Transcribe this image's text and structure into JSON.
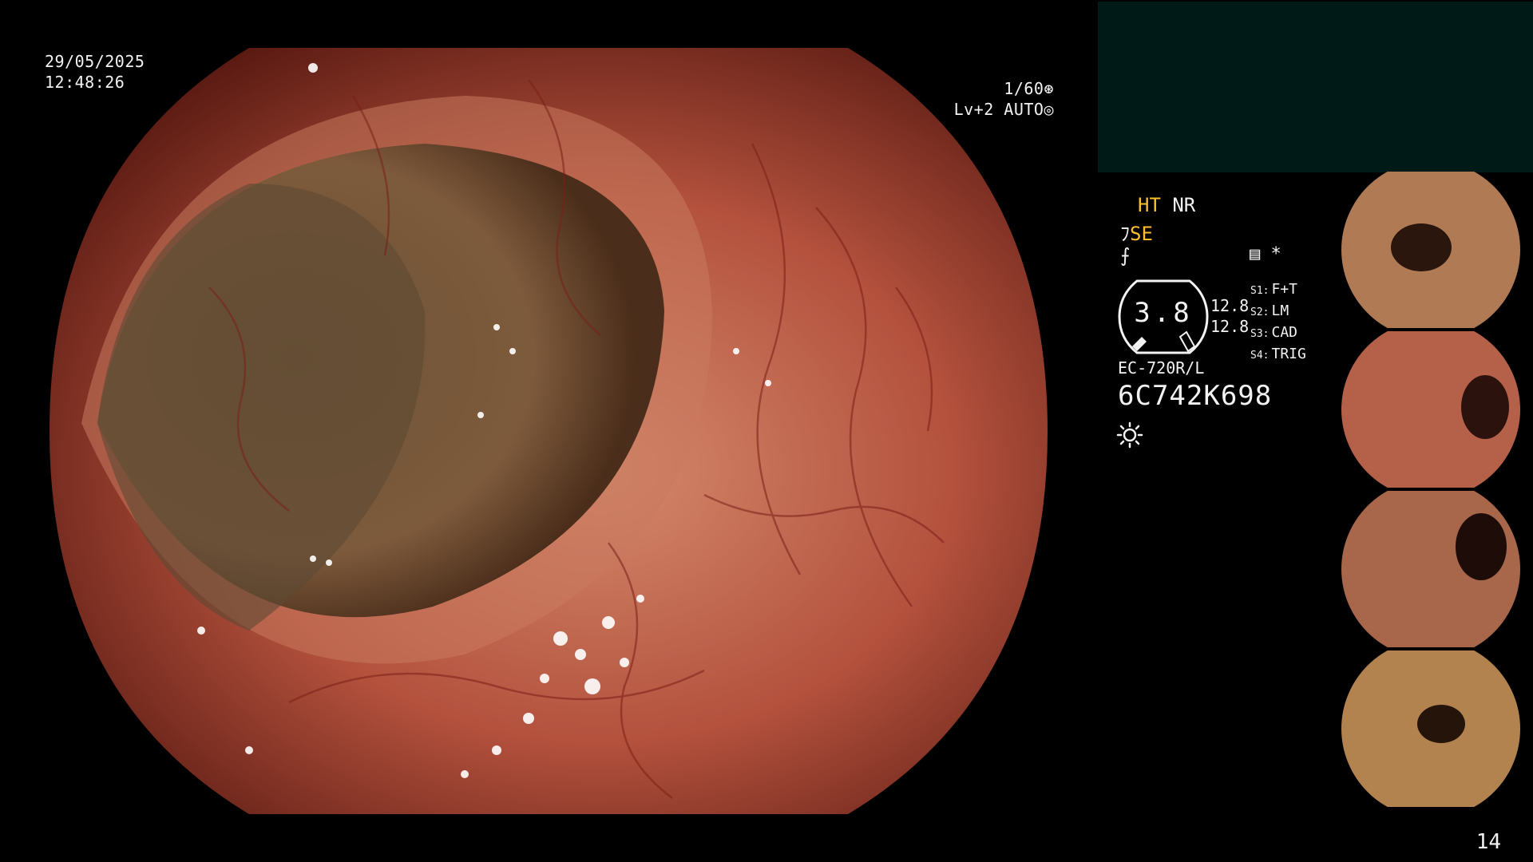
{
  "overlay": {
    "date": "29/05/2025",
    "time": "12:48:26",
    "shutter": "1/60",
    "level": "Lv+2 AUTO"
  },
  "status": {
    "ht": "HT",
    "nr": "NR",
    "se": "SE",
    "rec_marker": "*"
  },
  "zoom": {
    "value": "3.8",
    "iris_top": "12.8",
    "iris_bottom": "12.8"
  },
  "switches": [
    {
      "key": "S1:",
      "label": "F+T"
    },
    {
      "key": "S2:",
      "label": "LM"
    },
    {
      "key": "S3:",
      "label": "CAD"
    },
    {
      "key": "S4:",
      "label": "TRIG"
    }
  ],
  "scope": {
    "model": "EC-720R/L",
    "serial": "6C742K698"
  },
  "thumbnails": [
    {
      "tone": "#b07a55",
      "lumen": "#2a160c"
    },
    {
      "tone": "#b5614a",
      "lumen": "#2b120d"
    },
    {
      "tone": "#a8664a",
      "lumen": "#1d0c08"
    },
    {
      "tone": "#b3834f",
      "lumen": "#24140a"
    }
  ],
  "frame_counter": "14",
  "colors": {
    "accent": "#ffbf2e",
    "mucosa": "#b34b3a",
    "lumen": "#5a3c22"
  }
}
